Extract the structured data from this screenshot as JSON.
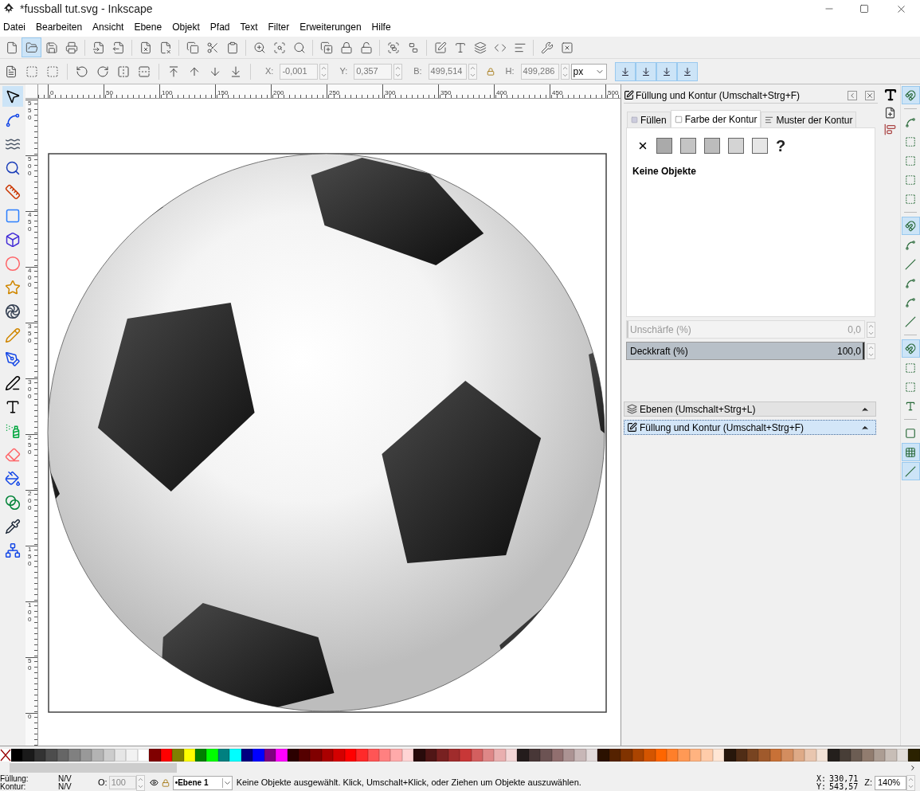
{
  "window": {
    "title": "*fussball tut.svg - Inkscape"
  },
  "menu": [
    "Datei",
    "Bearbeiten",
    "Ansicht",
    "Ebene",
    "Objekt",
    "Pfad",
    "Text",
    "Filter",
    "Erweiterungen",
    "Hilfe"
  ],
  "main_toolbar": [
    [
      {
        "highlighted": false
      },
      {
        "highlighted": true
      },
      {
        "highlighted": false
      },
      {
        "highlighted": false
      }
    ],
    [
      {
        "highlighted": false
      },
      {
        "highlighted": false
      }
    ],
    [
      {
        "highlighted": false
      },
      {
        "highlighted": false
      }
    ],
    [
      {
        "highlighted": false
      },
      {
        "highlighted": false
      },
      {
        "highlighted": false
      }
    ],
    [
      {
        "highlighted": false
      },
      {
        "highlighted": false
      },
      {
        "highlighted": false
      }
    ],
    [
      {
        "highlighted": false
      },
      {
        "highlighted": false
      },
      {
        "highlighted": false
      }
    ],
    [
      {
        "highlighted": false
      },
      {
        "highlighted": false
      }
    ],
    [
      {
        "highlighted": false
      },
      {
        "highlighted": false
      },
      {
        "highlighted": false
      },
      {
        "highlighted": false
      },
      {
        "highlighted": false
      }
    ],
    [
      {
        "highlighted": false
      },
      {
        "highlighted": false
      }
    ]
  ],
  "tool_controls": {
    "fields": [
      {
        "label": "X:",
        "value": "-0,001",
        "disabled": true
      },
      {
        "label": "Y:",
        "value": "0,357",
        "disabled": true
      },
      {
        "label": "B:",
        "value": "499,514",
        "disabled": true
      },
      {
        "label": "H:",
        "value": "499,286",
        "disabled": true
      }
    ],
    "unit": "px",
    "transform_toggles": [
      {
        "selected": true
      },
      {
        "selected": true
      },
      {
        "selected": true
      },
      {
        "selected": true
      }
    ]
  },
  "tools": [
    {
      "selected": true
    },
    {
      "selected": false
    },
    {
      "selected": false
    },
    {
      "selected": false
    },
    {
      "selected": false
    },
    {
      "selected": false
    },
    {
      "selected": false
    },
    {
      "selected": false
    },
    {
      "selected": false
    },
    {
      "selected": false
    },
    {
      "selected": false
    },
    {
      "selected": false
    },
    {
      "selected": false
    },
    {
      "selected": false
    },
    {
      "selected": false
    },
    {
      "selected": false
    },
    {
      "selected": false
    },
    {
      "selected": false
    },
    {
      "selected": false
    },
    {
      "selected": false
    }
  ],
  "rulers": {
    "horizontal": [
      "0",
      "50",
      "100",
      "150",
      "200",
      "250",
      "300",
      "350",
      "400",
      "450",
      "500"
    ],
    "vertical": [
      "550",
      "500",
      "450",
      "400",
      "350",
      "300",
      "250",
      "200",
      "150",
      "100",
      "50",
      "0"
    ]
  },
  "panel": {
    "title": "Füllung und Kontur (Umschalt+Strg+F)",
    "tabs": [
      {
        "label": "Füllen",
        "selected": false
      },
      {
        "label": "Farbe der Kontur",
        "selected": true
      },
      {
        "label": "Muster der Kontur",
        "selected": false
      }
    ],
    "unknown_paint": "?",
    "message": "Keine Objekte",
    "sliders": [
      {
        "label": "Unschärfe (%)",
        "value": "0,0",
        "level": 0,
        "disabled": true
      },
      {
        "label": "Deckkraft (%)",
        "value": "100,0",
        "level": 1,
        "disabled": false
      }
    ]
  },
  "docks": [
    {
      "title": "Ebenen (Umschalt+Strg+L)",
      "selected": false
    },
    {
      "title": "Füllung und Kontur (Umschalt+Strg+F)",
      "selected": true
    }
  ],
  "snap_bar": [
    {
      "kind": "button",
      "selected": true
    },
    {
      "kind": "separator"
    },
    {
      "kind": "button",
      "selected": false
    },
    {
      "kind": "button",
      "selected": false
    },
    {
      "kind": "button",
      "selected": false
    },
    {
      "kind": "button",
      "selected": false
    },
    {
      "kind": "button",
      "selected": false
    },
    {
      "kind": "separator"
    },
    {
      "kind": "button",
      "selected": true
    },
    {
      "kind": "button",
      "selected": false
    },
    {
      "kind": "button",
      "selected": false
    },
    {
      "kind": "button",
      "selected": false
    },
    {
      "kind": "button",
      "selected": false
    },
    {
      "kind": "button",
      "selected": false
    },
    {
      "kind": "separator"
    },
    {
      "kind": "button",
      "selected": true
    },
    {
      "kind": "button",
      "selected": false
    },
    {
      "kind": "button",
      "selected": false
    },
    {
      "kind": "button",
      "selected": false
    },
    {
      "kind": "separator"
    },
    {
      "kind": "button",
      "selected": false
    },
    {
      "kind": "button",
      "selected": true
    },
    {
      "kind": "button",
      "selected": true
    }
  ],
  "palette": [
    {
      "color": "#000000"
    },
    {
      "color": "#1a1a1a"
    },
    {
      "color": "#333333"
    },
    {
      "color": "#4d4d4d"
    },
    {
      "color": "#666666"
    },
    {
      "color": "#808080"
    },
    {
      "color": "#999999"
    },
    {
      "color": "#b3b3b3"
    },
    {
      "color": "#cccccc"
    },
    {
      "color": "#e6e6e6"
    },
    {
      "color": "#f2f2f2"
    },
    {
      "color": "#ffffff"
    },
    {
      "color": "#800000"
    },
    {
      "color": "#ff0000"
    },
    {
      "color": "#808000"
    },
    {
      "color": "#ffff00"
    },
    {
      "color": "#008000"
    },
    {
      "color": "#00ff00"
    },
    {
      "color": "#008080"
    },
    {
      "color": "#00ffff"
    },
    {
      "color": "#000080"
    },
    {
      "color": "#0000ff"
    },
    {
      "color": "#800080"
    },
    {
      "color": "#ff00ff"
    },
    {
      "color": "#2b0000"
    },
    {
      "color": "#550000"
    },
    {
      "color": "#800000"
    },
    {
      "color": "#aa0000"
    },
    {
      "color": "#d40000"
    },
    {
      "color": "#ff0000"
    },
    {
      "color": "#ff2a2a"
    },
    {
      "color": "#ff5555"
    },
    {
      "color": "#ff8080"
    },
    {
      "color": "#ffaaaa"
    },
    {
      "color": "#ffd5d5"
    },
    {
      "color": "#280b0b"
    },
    {
      "color": "#501616"
    },
    {
      "color": "#782121"
    },
    {
      "color": "#a02c2c"
    },
    {
      "color": "#c83737"
    },
    {
      "color": "#d35f5f"
    },
    {
      "color": "#de8787"
    },
    {
      "color": "#e9afaf"
    },
    {
      "color": "#f4d7d7"
    },
    {
      "color": "#241c1c"
    },
    {
      "color": "#483737"
    },
    {
      "color": "#6c5353"
    },
    {
      "color": "#916f6f"
    },
    {
      "color": "#ac9393"
    },
    {
      "color": "#c8b7b7"
    },
    {
      "color": "#e3dbdb"
    },
    {
      "color": "#2b1100"
    },
    {
      "color": "#552200"
    },
    {
      "color": "#803300"
    },
    {
      "color": "#aa4400"
    },
    {
      "color": "#d45500"
    },
    {
      "color": "#ff6600"
    },
    {
      "color": "#ff7f2a"
    },
    {
      "color": "#ff9955"
    },
    {
      "color": "#ffb380"
    },
    {
      "color": "#ffccaa"
    },
    {
      "color": "#ffe6d5"
    },
    {
      "color": "#28170b"
    },
    {
      "color": "#502d16"
    },
    {
      "color": "#784421"
    },
    {
      "color": "#a05a2c"
    },
    {
      "color": "#c87137"
    },
    {
      "color": "#d38d5f"
    },
    {
      "color": "#deaa87"
    },
    {
      "color": "#e9c6af"
    },
    {
      "color": "#f4e3d7"
    },
    {
      "color": "#241f1c"
    },
    {
      "color": "#483e37"
    },
    {
      "color": "#6c5d53"
    },
    {
      "color": "#917c6f"
    },
    {
      "color": "#ac9d93"
    },
    {
      "color": "#c8beb7"
    },
    {
      "color": "#e3dedb"
    },
    {
      "color": "#2b2200"
    }
  ],
  "status_bar": {
    "fill_label": "Füllung:",
    "fill_value": "N/V",
    "stroke_label": "Kontur:",
    "stroke_value": "N/V",
    "opacity_label": "O:",
    "opacity_value": "100",
    "layer": "•Ebene 1",
    "message": "Keine Objekte ausgewählt. Klick, Umschalt+Klick, oder Ziehen um Objekte auszuwählen.",
    "x_label": "X:",
    "x_value": "330,71",
    "y_label": "Y:",
    "y_value": "543,57",
    "zoom_label": "Z:",
    "zoom_value": "140%"
  }
}
